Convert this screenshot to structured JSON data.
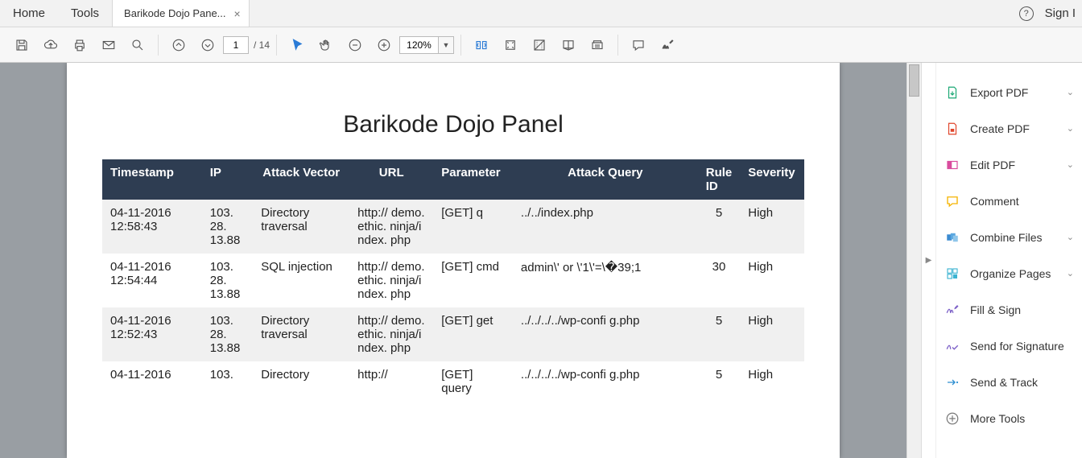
{
  "nav": {
    "home": "Home",
    "tools": "Tools",
    "tab_title": "Barikode Dojo Pane...",
    "sign_in": "Sign I"
  },
  "toolbar": {
    "page_current": "1",
    "page_total": "/  14",
    "zoom": "120%"
  },
  "doc": {
    "title": "Barikode Dojo Panel",
    "columns": [
      "Timestamp",
      "IP",
      "Attack Vector",
      "URL",
      "Parameter",
      "Attack Query",
      "Rule ID",
      "Severity"
    ],
    "rows": [
      {
        "ts": "04-11-2016 12:58:43",
        "ip": "103. 28. 13.88",
        "vec": "Directory traversal",
        "url": "http:// demo.ethic. ninja/index. php",
        "param": "[GET] q",
        "query": "../../index.php",
        "rule": "5",
        "sev": "High"
      },
      {
        "ts": "04-11-2016 12:54:44",
        "ip": "103. 28. 13.88",
        "vec": "SQL injection",
        "url": "http:// demo.ethic. ninja/index. php",
        "param": "[GET] cmd",
        "query": "admin\\' or \\'1\\'=\\�39;1",
        "rule": "30",
        "sev": "High"
      },
      {
        "ts": "04-11-2016 12:52:43",
        "ip": "103. 28. 13.88",
        "vec": "Directory traversal",
        "url": "http:// demo.ethic. ninja/index. php",
        "param": "[GET] get",
        "query": "../../../../wp-confi g.php",
        "rule": "5",
        "sev": "High"
      },
      {
        "ts": "04-11-2016",
        "ip": "103.",
        "vec": "Directory",
        "url": "http://",
        "param": "[GET] query",
        "query": "../../../../wp-confi g.php",
        "rule": "5",
        "sev": "High"
      }
    ]
  },
  "panel": {
    "items": [
      {
        "label": "Export PDF",
        "chev": true
      },
      {
        "label": "Create PDF",
        "chev": true
      },
      {
        "label": "Edit PDF",
        "chev": true
      },
      {
        "label": "Comment",
        "chev": false
      },
      {
        "label": "Combine Files",
        "chev": true
      },
      {
        "label": "Organize Pages",
        "chev": true
      },
      {
        "label": "Fill & Sign",
        "chev": false
      },
      {
        "label": "Send for Signature",
        "chev": false
      },
      {
        "label": "Send & Track",
        "chev": false
      },
      {
        "label": "More Tools",
        "chev": false
      }
    ]
  }
}
